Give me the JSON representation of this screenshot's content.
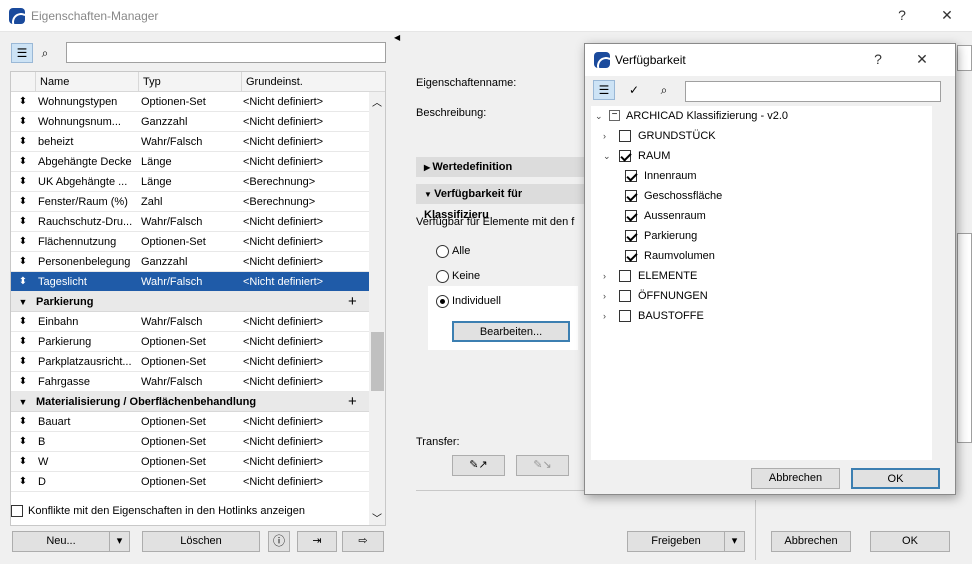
{
  "main": {
    "title": "Eigenschaften-Manager",
    "help": "?",
    "close": "✕",
    "columns": [
      "Name",
      "Typ",
      "Grundeinst."
    ],
    "rows": [
      {
        "name": "Wohnungstypen",
        "type": "Optionen-Set",
        "default": "<Nicht definiert>"
      },
      {
        "name": "Wohnungsnum...",
        "type": "Ganzzahl",
        "default": "<Nicht definiert>"
      },
      {
        "name": "beheizt",
        "type": "Wahr/Falsch",
        "default": "<Nicht definiert>"
      },
      {
        "name": "Abgehängte Decke",
        "type": "Länge",
        "default": "<Nicht definiert>"
      },
      {
        "name": "UK Abgehängte ...",
        "type": "Länge",
        "default": "<Berechnung>"
      },
      {
        "name": "Fenster/Raum (%)",
        "type": "Zahl",
        "default": "<Berechnung>"
      },
      {
        "name": "Rauchschutz-Dru...",
        "type": "Wahr/Falsch",
        "default": "<Nicht definiert>"
      },
      {
        "name": "Flächennutzung",
        "type": "Optionen-Set",
        "default": "<Nicht definiert>"
      },
      {
        "name": "Personenbelegung",
        "type": "Ganzzahl",
        "default": "<Nicht definiert>"
      },
      {
        "name": "Tageslicht",
        "type": "Wahr/Falsch",
        "default": "<Nicht definiert>",
        "selected": true
      }
    ],
    "group1": {
      "label": "Parkierung",
      "rows": [
        {
          "name": "Einbahn",
          "type": "Wahr/Falsch",
          "default": "<Nicht definiert>"
        },
        {
          "name": "Parkierung",
          "type": "Optionen-Set",
          "default": "<Nicht definiert>"
        },
        {
          "name": "Parkplatzausricht...",
          "type": "Optionen-Set",
          "default": "<Nicht definiert>"
        },
        {
          "name": "Fahrgasse",
          "type": "Wahr/Falsch",
          "default": "<Nicht definiert>"
        }
      ]
    },
    "group2": {
      "label": "Materialisierung / Oberflächenbehandlung",
      "rows": [
        {
          "name": "Bauart",
          "type": "Optionen-Set",
          "default": "<Nicht definiert>"
        },
        {
          "name": "B",
          "type": "Optionen-Set",
          "default": "<Nicht definiert>"
        },
        {
          "name": "W",
          "type": "Optionen-Set",
          "default": "<Nicht definiert>"
        },
        {
          "name": "D",
          "type": "Optionen-Set",
          "default": "<Nicht definiert>"
        }
      ]
    },
    "conflicts_label": "Konflikte mit den Eigenschaften in den Hotlinks anzeigen",
    "new_button": "Neu...",
    "delete_button": "Löschen",
    "info_icon": "ⓘ",
    "property_name_label": "Eigenschaftenname:",
    "description_label": "Beschreibung:",
    "section_values": "Wertedefinition",
    "section_availability": "Verfügbarkeit für Klassifizieru",
    "available_for": "Verfügbar für Elemente mit den f",
    "radio_all": "Alle",
    "radio_none": "Keine",
    "radio_individual": "Individuell",
    "edit_button": "Bearbeiten...",
    "transfer_label": "Transfer:",
    "share_button": "Freigeben",
    "cancel_button": "Abbrechen",
    "ok_button": "OK"
  },
  "dialog": {
    "title": "Verfügbarkeit",
    "help": "?",
    "close": "✕",
    "root": "ARCHICAD Klassifizierung - v2.0",
    "nodes": [
      {
        "label": "GRUNDSTÜCK",
        "checked": false,
        "expanded": false
      },
      {
        "label": "RAUM",
        "checked": true,
        "expanded": true,
        "children": [
          "Innenraum",
          "Geschossfläche",
          "Aussenraum",
          "Parkierung",
          "Raumvolumen"
        ]
      },
      {
        "label": "ELEMENTE",
        "checked": false,
        "expanded": false
      },
      {
        "label": "ÖFFNUNGEN",
        "checked": false,
        "expanded": false
      },
      {
        "label": "BAUSTOFFE",
        "checked": false,
        "expanded": false
      }
    ],
    "cancel_button": "Abbrechen",
    "ok_button": "OK"
  }
}
